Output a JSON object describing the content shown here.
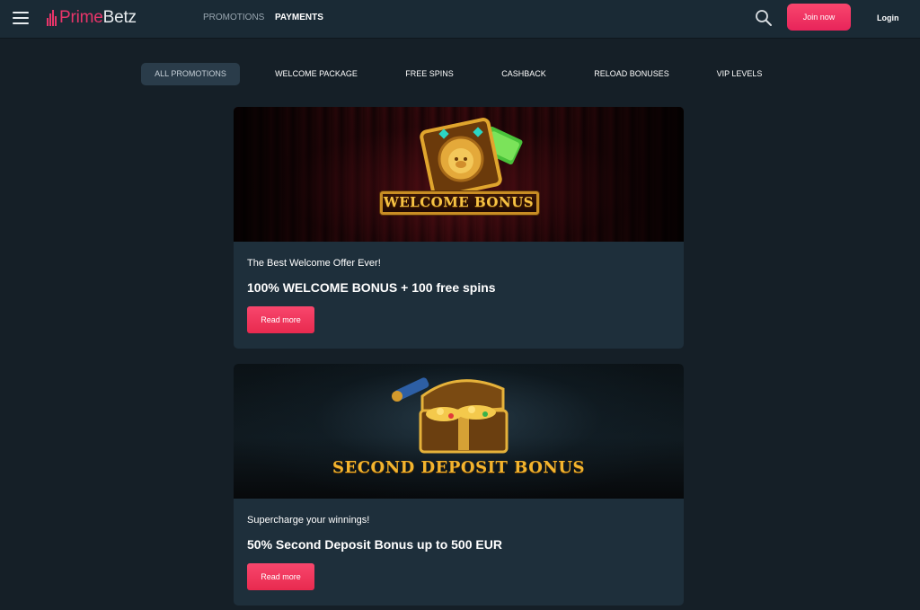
{
  "header": {
    "logo": {
      "part1": "Prime",
      "part2": "Betz"
    },
    "nav": {
      "promotions": "PROMOTIONS",
      "payments": "PAYMENTS"
    },
    "join_label": "Join now",
    "login_label": "Login"
  },
  "tabs": [
    {
      "label": "ALL PROMOTIONS",
      "active": true
    },
    {
      "label": "WELCOME PACKAGE",
      "active": false
    },
    {
      "label": "FREE SPINS",
      "active": false
    },
    {
      "label": "CASHBACK",
      "active": false
    },
    {
      "label": "RELOAD BONUSES",
      "active": false
    },
    {
      "label": "VIP LEVELS",
      "active": false
    }
  ],
  "promotions": [
    {
      "banner_text": "WELCOME BONUS",
      "subtitle": "The Best Welcome Offer Ever!",
      "title": "100% WELCOME BONUS + 100 free spins",
      "button_label": "Read more"
    },
    {
      "banner_text": "SECOND DEPOSIT BONUS",
      "subtitle": "Supercharge your winnings!",
      "title": "50% Second Deposit Bonus up to 500 EUR",
      "button_label": "Read more"
    }
  ],
  "colors": {
    "background": "#151f27",
    "header": "#1a2a35",
    "card": "#1e2f3b",
    "accent": "#f0355f",
    "banner_gold": "#f2b634"
  },
  "icons": [
    "menu-icon",
    "logo-bars-icon",
    "search-icon"
  ]
}
